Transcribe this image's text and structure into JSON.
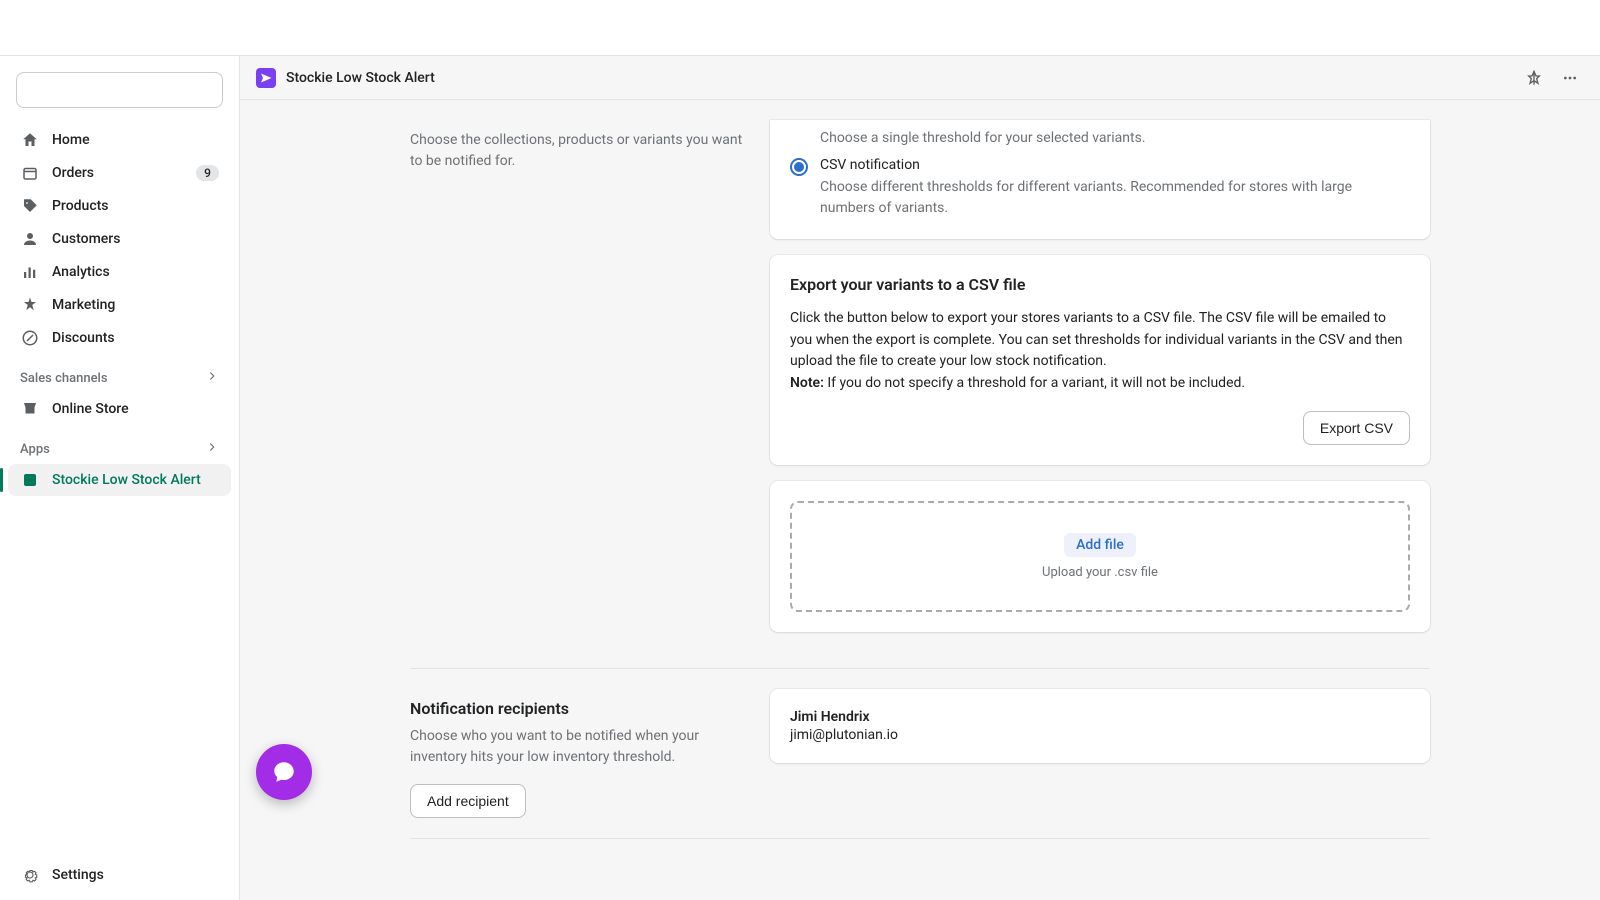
{
  "app_header": {
    "title": "Stockie Low Stock Alert"
  },
  "sidebar": {
    "items": [
      {
        "label": "Home"
      },
      {
        "label": "Orders",
        "badge": "9"
      },
      {
        "label": "Products"
      },
      {
        "label": "Customers"
      },
      {
        "label": "Analytics"
      },
      {
        "label": "Marketing"
      },
      {
        "label": "Discounts"
      }
    ],
    "sales_channels_label": "Sales channels",
    "online_store_label": "Online Store",
    "apps_label": "Apps",
    "app_item_label": "Stockie Low Stock Alert",
    "settings_label": "Settings"
  },
  "products_section": {
    "desc": "Choose the collections, products or variants you want to be notified for."
  },
  "notification_type": {
    "simple_desc": "Choose a single threshold for your selected variants.",
    "csv_label": "CSV notification",
    "csv_desc": "Choose different thresholds for different variants. Recommended for stores with large numbers of variants."
  },
  "export_card": {
    "title": "Export your variants to a CSV file",
    "body": "Click the button below to export your stores variants to a CSV file. The CSV file will be emailed to you when the export is complete. You can set thresholds for individual variants in the CSV and then upload the file to create your low stock notification.",
    "note_label": "Note:",
    "note_text": " If you do not specify a threshold for a variant, it will not be included.",
    "button": "Export CSV"
  },
  "upload_card": {
    "add_file": "Add file",
    "hint": "Upload your .csv file"
  },
  "recipients_section": {
    "title": "Notification recipients",
    "desc": "Choose who you want to be notified when your inventory hits your low inventory threshold.",
    "add_button": "Add recipient",
    "recipient": {
      "name": "Jimi Hendrix",
      "email": "jimi@plutonian.io"
    }
  }
}
